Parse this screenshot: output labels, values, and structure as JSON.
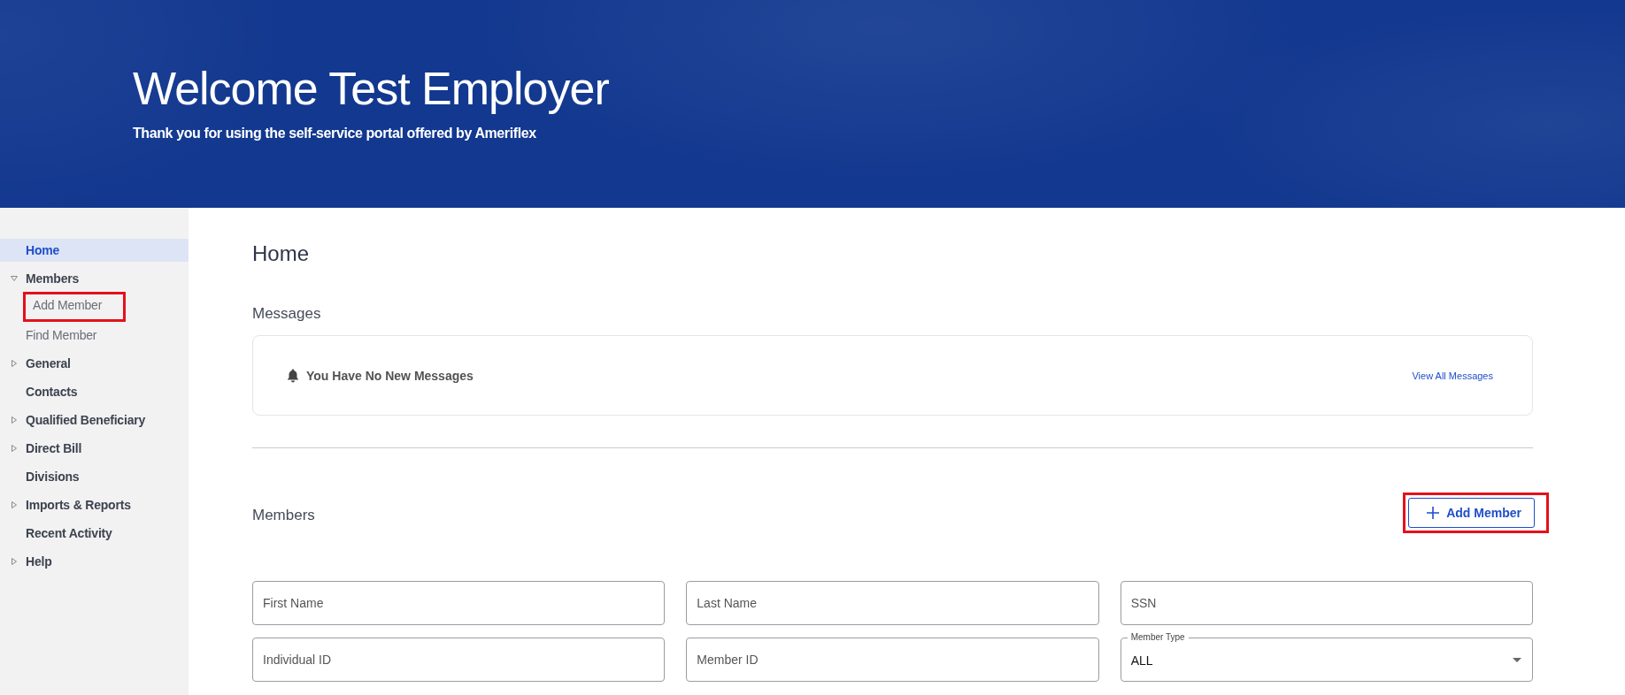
{
  "header": {
    "title": "Welcome Test Employer",
    "subtitle": "Thank you for using the self-service portal offered by Ameriflex"
  },
  "sidebar": {
    "items": [
      {
        "label": "Home",
        "kind": "link",
        "selected": true,
        "annotated": false
      },
      {
        "label": "Members",
        "kind": "group",
        "expanded": true,
        "selected": false,
        "annotated": false,
        "children": [
          {
            "label": "Add Member",
            "selected": false,
            "annotated": true
          },
          {
            "label": "Find Member",
            "selected": false,
            "annotated": false
          }
        ]
      },
      {
        "label": "General",
        "kind": "group",
        "expanded": false,
        "selected": false,
        "annotated": false
      },
      {
        "label": "Contacts",
        "kind": "link",
        "selected": false,
        "annotated": false
      },
      {
        "label": "Qualified Beneficiary",
        "kind": "group",
        "expanded": false,
        "selected": false,
        "annotated": false
      },
      {
        "label": "Direct Bill",
        "kind": "group",
        "expanded": false,
        "selected": false,
        "annotated": false
      },
      {
        "label": "Divisions",
        "kind": "link",
        "selected": false,
        "annotated": false
      },
      {
        "label": "Imports & Reports",
        "kind": "group",
        "expanded": false,
        "selected": false,
        "annotated": false
      },
      {
        "label": "Recent Activity",
        "kind": "link",
        "selected": false,
        "annotated": false
      },
      {
        "label": "Help",
        "kind": "group",
        "expanded": false,
        "selected": false,
        "annotated": false
      }
    ]
  },
  "page_title": "Home",
  "messages": {
    "heading": "Messages",
    "text": "You Have No New Messages",
    "link": "View All Messages"
  },
  "members": {
    "heading": "Members",
    "add_button": {
      "label": "Add Member",
      "annotated": true
    },
    "fields": [
      {
        "kind": "text",
        "placeholder": "First Name"
      },
      {
        "kind": "text",
        "placeholder": "Last Name"
      },
      {
        "kind": "text",
        "placeholder": "SSN"
      },
      {
        "kind": "text",
        "placeholder": "Individual ID"
      },
      {
        "kind": "text",
        "placeholder": "Member ID"
      },
      {
        "kind": "select",
        "label": "Member Type",
        "value": "ALL"
      }
    ]
  }
}
